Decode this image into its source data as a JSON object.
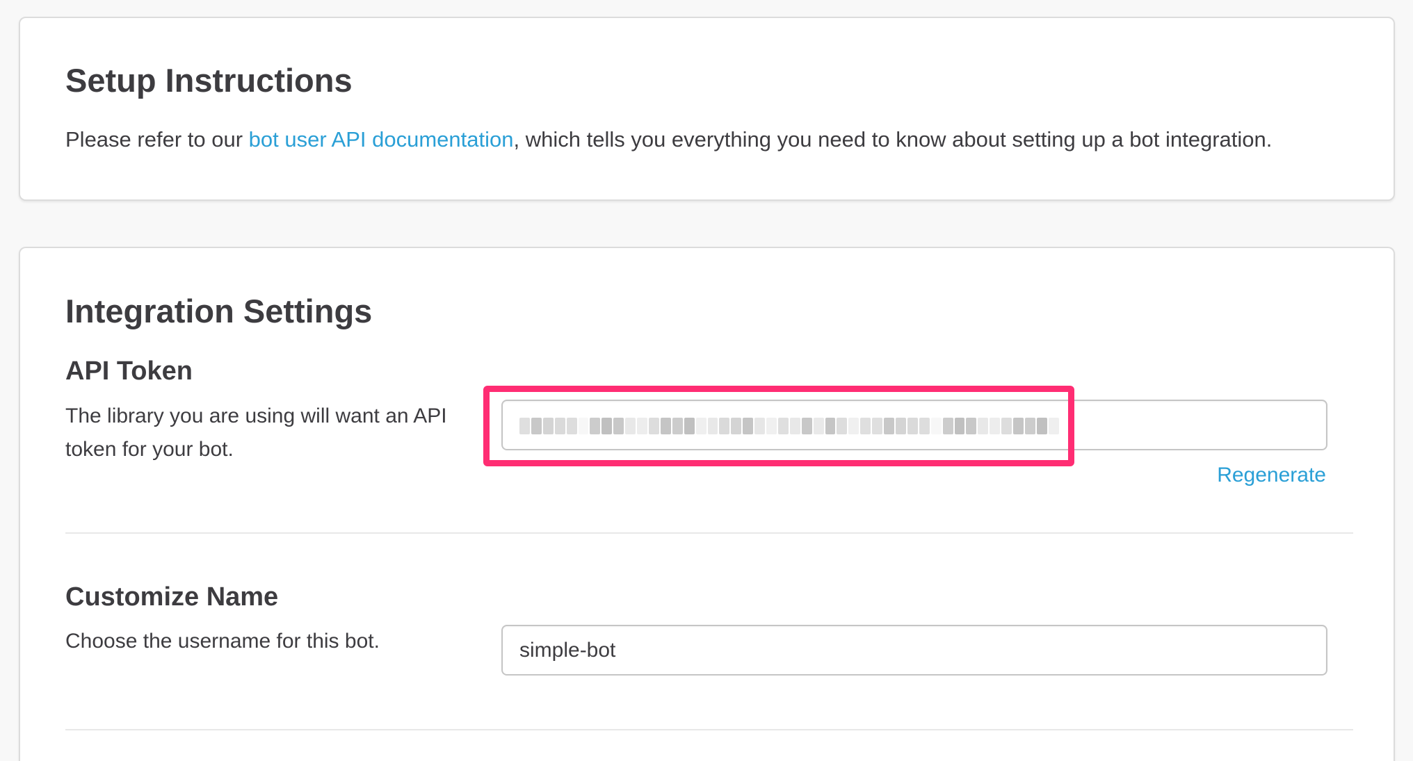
{
  "setup": {
    "title": "Setup Instructions",
    "text_before": "Please refer to our ",
    "link_text": "bot user API documentation",
    "text_after": ", which tells you everything you need to know about setting up a bot integration."
  },
  "integration": {
    "title": "Integration Settings",
    "api_token": {
      "heading": "API Token",
      "description": "The library you are using will want an API token for your bot.",
      "value_state": "blurred",
      "regenerate_label": "Regenerate",
      "highlight_color": "#ff2d73"
    },
    "customize_name": {
      "heading": "Customize Name",
      "description": "Choose the username for this bot.",
      "value": "simple-bot"
    }
  },
  "colors": {
    "link": "#2a9fd6",
    "text": "#3d3c40",
    "background": "#f8f8f8"
  }
}
